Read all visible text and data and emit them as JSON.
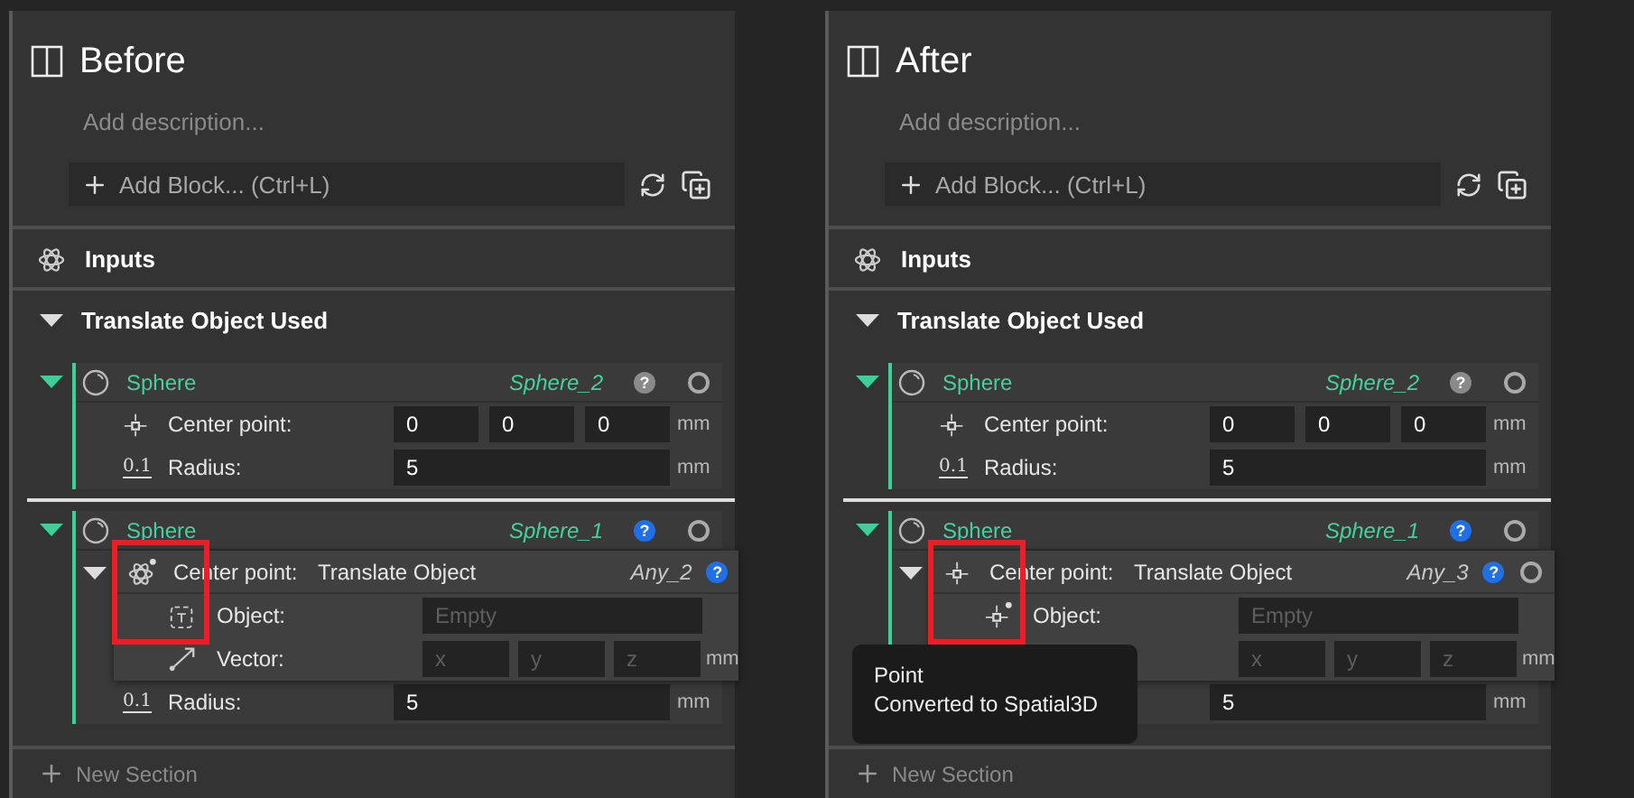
{
  "panels": [
    {
      "title": "Before",
      "description_placeholder": "Add description...",
      "add_block": "Add Block... (Ctrl+L)",
      "inputs_label": "Inputs",
      "section": {
        "title": "Translate Object Used",
        "expanded": true
      },
      "spheres": [
        {
          "name": "Sphere",
          "variable": "Sphere_2",
          "help": "?",
          "help_active": false,
          "status_icon": true,
          "expanded": true,
          "params": [
            {
              "kind": "vector",
              "label": "Center point:",
              "values": [
                "0",
                "0",
                "0"
              ],
              "unit": "mm"
            },
            {
              "kind": "number",
              "icon_text": "0.1",
              "label": "Radius:",
              "value": "5",
              "unit": "mm"
            }
          ]
        },
        {
          "name": "Sphere",
          "variable": "Sphere_1",
          "help": "?",
          "help_active": true,
          "status_icon": true,
          "expanded": true,
          "params": [
            {
              "kind": "linked",
              "converted": false,
              "icon_dot": true,
              "label": "Center point:",
              "expanded": true,
              "highlighted": true,
              "linked": {
                "title": "Translate Object",
                "variable": "Any_2",
                "help": "?",
                "help_active": true,
                "params": [
                  {
                    "kind": "object",
                    "converted": false,
                    "icon_dot": false,
                    "label": "Object:",
                    "placeholder": "Empty"
                  },
                  {
                    "kind": "vector",
                    "label": "Vector:",
                    "placeholders": [
                      "x",
                      "y",
                      "z"
                    ],
                    "unit": "mm"
                  }
                ]
              }
            },
            {
              "kind": "number",
              "icon_text": "0.1",
              "label": "Radius:",
              "value": "5",
              "unit": "mm"
            }
          ]
        }
      ],
      "new_section": "New Section"
    },
    {
      "title": "After",
      "description_placeholder": "Add description...",
      "add_block": "Add Block... (Ctrl+L)",
      "inputs_label": "Inputs",
      "section": {
        "title": "Translate Object Used",
        "expanded": true
      },
      "spheres": [
        {
          "name": "Sphere",
          "variable": "Sphere_2",
          "help": "?",
          "help_active": false,
          "status_icon": true,
          "expanded": true,
          "params": [
            {
              "kind": "vector",
              "label": "Center point:",
              "values": [
                "0",
                "0",
                "0"
              ],
              "unit": "mm"
            },
            {
              "kind": "number",
              "icon_text": "0.1",
              "label": "Radius:",
              "value": "5",
              "unit": "mm"
            }
          ]
        },
        {
          "name": "Sphere",
          "variable": "Sphere_1",
          "help": "?",
          "help_active": true,
          "status_icon": true,
          "expanded": true,
          "params": [
            {
              "kind": "linked",
              "converted": true,
              "icon_dot": false,
              "label": "Center point:",
              "expanded": true,
              "highlighted": true,
              "linked": {
                "title": "Translate Object",
                "variable": "Any_3",
                "help": "?",
                "help_active": true,
                "status_icon": true,
                "params": [
                  {
                    "kind": "object",
                    "converted": true,
                    "icon_dot": true,
                    "label": "Object:",
                    "placeholder": "Empty",
                    "tooltip": {
                      "title": "Point",
                      "text": "Converted to Spatial3D"
                    }
                  },
                  {
                    "kind": "vector",
                    "placeholders": [
                      "x",
                      "y",
                      "z"
                    ],
                    "unit": "mm"
                  }
                ]
              }
            },
            {
              "kind": "number",
              "value": "5",
              "unit": "mm"
            }
          ]
        }
      ],
      "new_section": "New Section"
    }
  ]
}
